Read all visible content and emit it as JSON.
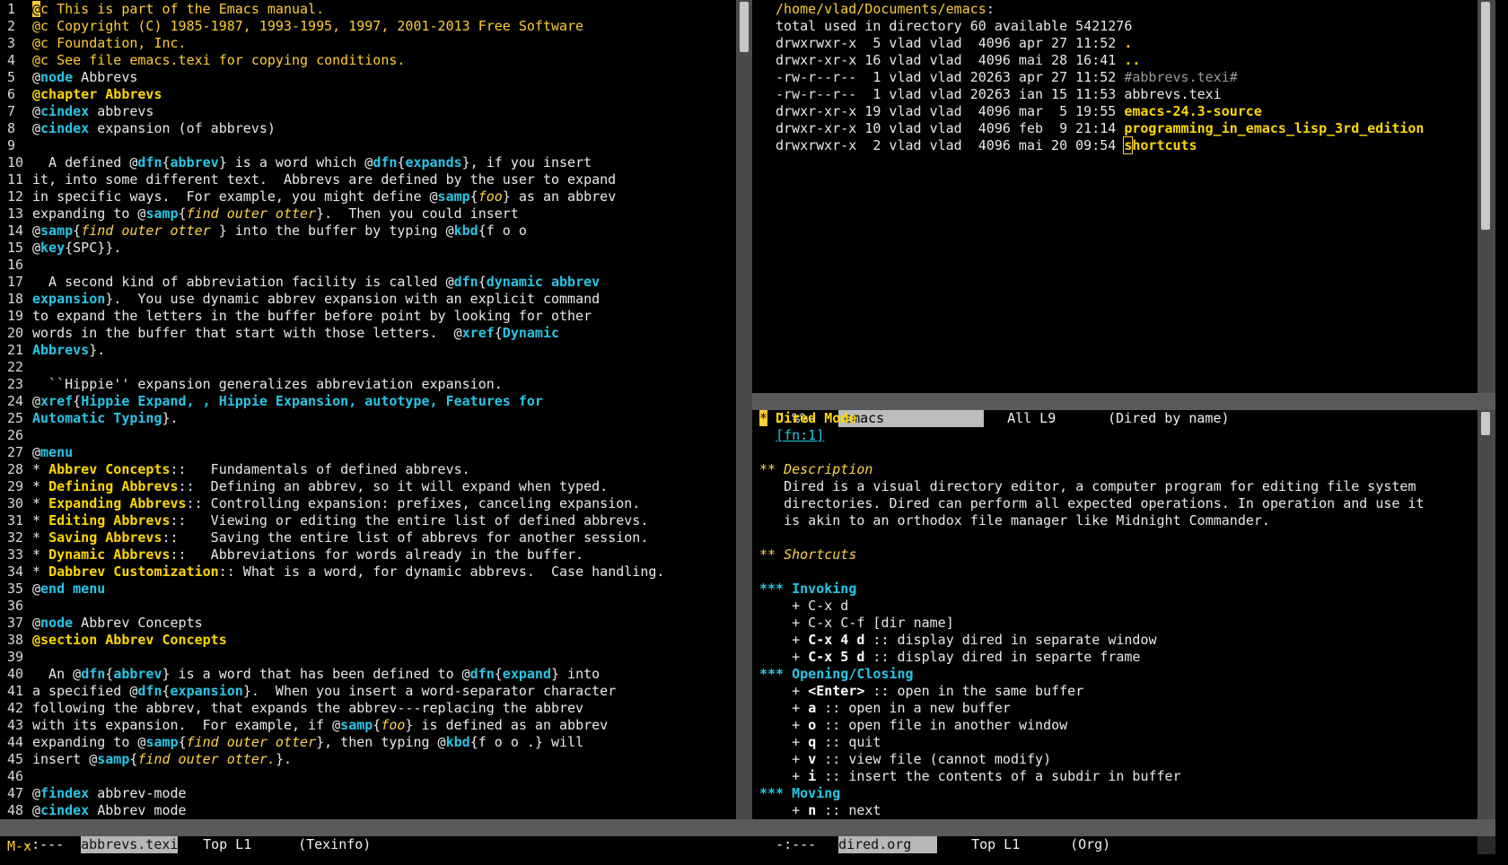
{
  "left": {
    "lines": [
      {
        "n": "1",
        "segs": [
          [
            "cursor",
            "@"
          ],
          [
            "c-yel",
            "c This is part of the Emacs manual."
          ]
        ]
      },
      {
        "n": "2",
        "segs": [
          [
            "c-yel",
            "@c Copyright (C) 1985-1987, 1993-1995, 1997, 2001-2013 Free Software"
          ]
        ]
      },
      {
        "n": "3",
        "segs": [
          [
            "c-yel",
            "@c Foundation, Inc."
          ]
        ]
      },
      {
        "n": "4",
        "segs": [
          [
            "c-yel",
            "@c See file emacs.texi for copying conditions."
          ]
        ]
      },
      {
        "n": "5",
        "segs": [
          [
            "",
            "@"
          ],
          [
            "c-cyanb",
            "node"
          ],
          [
            "",
            " Abbrevs"
          ]
        ]
      },
      {
        "n": "6",
        "segs": [
          [
            "c-kw",
            "@chapter Abbrevs"
          ]
        ]
      },
      {
        "n": "7",
        "segs": [
          [
            "",
            "@"
          ],
          [
            "c-cyanb",
            "cindex"
          ],
          [
            "",
            " abbrevs"
          ]
        ]
      },
      {
        "n": "8",
        "segs": [
          [
            "",
            "@"
          ],
          [
            "c-cyanb",
            "cindex"
          ],
          [
            "",
            " expansion (of abbrevs)"
          ]
        ]
      },
      {
        "n": "9",
        "segs": []
      },
      {
        "n": "10",
        "segs": [
          [
            "",
            "  A defined @"
          ],
          [
            "c-cyanb",
            "dfn"
          ],
          [
            "",
            "{"
          ],
          [
            "c-cyanb",
            "abbrev"
          ],
          [
            "",
            "} is a word which @"
          ],
          [
            "c-cyanb",
            "dfn"
          ],
          [
            "",
            "{"
          ],
          [
            "c-cyanb",
            "expands"
          ],
          [
            "",
            "}, if you insert"
          ]
        ]
      },
      {
        "n": "11",
        "segs": [
          [
            "",
            "it, into some different text.  Abbrevs are defined by the user to expand"
          ]
        ]
      },
      {
        "n": "12",
        "segs": [
          [
            "",
            "in specific ways.  For example, you might define @"
          ],
          [
            "c-cyanb",
            "samp"
          ],
          [
            "",
            "{"
          ],
          [
            "c-ital",
            "foo"
          ],
          [
            "",
            "} as an abbrev"
          ]
        ]
      },
      {
        "n": "13",
        "segs": [
          [
            "",
            "expanding to @"
          ],
          [
            "c-cyanb",
            "samp"
          ],
          [
            "",
            "{"
          ],
          [
            "c-ital",
            "find outer otter"
          ],
          [
            "",
            "}.  Then you could insert"
          ]
        ]
      },
      {
        "n": "14",
        "segs": [
          [
            "",
            "@"
          ],
          [
            "c-cyanb",
            "samp"
          ],
          [
            "",
            "{"
          ],
          [
            "c-ital",
            "find outer otter "
          ],
          [
            "",
            "} into the buffer by typing @"
          ],
          [
            "c-cyanb",
            "kbd"
          ],
          [
            "",
            "{f o o"
          ]
        ]
      },
      {
        "n": "15",
        "segs": [
          [
            "",
            "@"
          ],
          [
            "c-cyanb",
            "key"
          ],
          [
            "",
            "{SPC}}."
          ]
        ]
      },
      {
        "n": "16",
        "segs": []
      },
      {
        "n": "17",
        "segs": [
          [
            "",
            "  A second kind of abbreviation facility is called @"
          ],
          [
            "c-cyanb",
            "dfn"
          ],
          [
            "",
            "{"
          ],
          [
            "c-cyanb",
            "dynamic abbrev"
          ]
        ]
      },
      {
        "n": "18",
        "segs": [
          [
            "c-cyanb",
            "expansion"
          ],
          [
            "",
            "}.  You use dynamic abbrev expansion with an explicit command"
          ]
        ]
      },
      {
        "n": "19",
        "segs": [
          [
            "",
            "to expand the letters in the buffer before point by looking for other"
          ]
        ]
      },
      {
        "n": "20",
        "segs": [
          [
            "",
            "words in the buffer that start with those letters.  @"
          ],
          [
            "c-cyanb",
            "xref"
          ],
          [
            "",
            "{"
          ],
          [
            "c-cyanb",
            "Dynamic"
          ]
        ]
      },
      {
        "n": "21",
        "segs": [
          [
            "c-cyanb",
            "Abbrevs"
          ],
          [
            "",
            "}."
          ]
        ]
      },
      {
        "n": "22",
        "segs": []
      },
      {
        "n": "23",
        "segs": [
          [
            "",
            "  ``Hippie'' expansion generalizes abbreviation expansion."
          ]
        ]
      },
      {
        "n": "24",
        "segs": [
          [
            "",
            "@"
          ],
          [
            "c-cyanb",
            "xref"
          ],
          [
            "",
            "{"
          ],
          [
            "c-cyanb",
            "Hippie Expand, , Hippie Expansion, autotype, Features for"
          ]
        ]
      },
      {
        "n": "25",
        "segs": [
          [
            "c-cyanb",
            "Automatic Typing"
          ],
          [
            "",
            "}."
          ]
        ]
      },
      {
        "n": "26",
        "segs": []
      },
      {
        "n": "27",
        "segs": [
          [
            "",
            "@"
          ],
          [
            "c-cyanb",
            "menu"
          ]
        ]
      },
      {
        "n": "28",
        "segs": [
          [
            "",
            "* "
          ],
          [
            "c-kw",
            "Abbrev Concepts"
          ],
          [
            "",
            "::   Fundamentals of defined abbrevs."
          ]
        ]
      },
      {
        "n": "29",
        "segs": [
          [
            "",
            "* "
          ],
          [
            "c-kw",
            "Defining Abbrevs"
          ],
          [
            "",
            "::  Defining an abbrev, so it will expand when typed."
          ]
        ]
      },
      {
        "n": "30",
        "segs": [
          [
            "",
            "* "
          ],
          [
            "c-kw",
            "Expanding Abbrevs"
          ],
          [
            "",
            ":: Controlling expansion: prefixes, canceling expansion."
          ]
        ]
      },
      {
        "n": "31",
        "segs": [
          [
            "",
            "* "
          ],
          [
            "c-kw",
            "Editing Abbrevs"
          ],
          [
            "",
            "::   Viewing or editing the entire list of defined abbrevs."
          ]
        ]
      },
      {
        "n": "32",
        "segs": [
          [
            "",
            "* "
          ],
          [
            "c-kw",
            "Saving Abbrevs"
          ],
          [
            "",
            "::    Saving the entire list of abbrevs for another session."
          ]
        ]
      },
      {
        "n": "33",
        "segs": [
          [
            "",
            "* "
          ],
          [
            "c-kw",
            "Dynamic Abbrevs"
          ],
          [
            "",
            "::   Abbreviations for words already in the buffer."
          ]
        ]
      },
      {
        "n": "34",
        "segs": [
          [
            "",
            "* "
          ],
          [
            "c-kw",
            "Dabbrev Customization"
          ],
          [
            "",
            ":: What is a word, for dynamic abbrevs.  Case handling."
          ]
        ]
      },
      {
        "n": "35",
        "segs": [
          [
            "",
            "@"
          ],
          [
            "c-cyanb",
            "end menu"
          ]
        ]
      },
      {
        "n": "36",
        "segs": []
      },
      {
        "n": "37",
        "segs": [
          [
            "",
            "@"
          ],
          [
            "c-cyanb",
            "node"
          ],
          [
            "",
            " Abbrev Concepts"
          ]
        ]
      },
      {
        "n": "38",
        "segs": [
          [
            "c-kw",
            "@section Abbrev Concepts"
          ]
        ]
      },
      {
        "n": "39",
        "segs": []
      },
      {
        "n": "40",
        "segs": [
          [
            "",
            "  An @"
          ],
          [
            "c-cyanb",
            "dfn"
          ],
          [
            "",
            "{"
          ],
          [
            "c-cyanb",
            "abbrev"
          ],
          [
            "",
            "} is a word that has been defined to @"
          ],
          [
            "c-cyanb",
            "dfn"
          ],
          [
            "",
            "{"
          ],
          [
            "c-cyanb",
            "expand"
          ],
          [
            "",
            "} into"
          ]
        ]
      },
      {
        "n": "41",
        "segs": [
          [
            "",
            "a specified @"
          ],
          [
            "c-cyanb",
            "dfn"
          ],
          [
            "",
            "{"
          ],
          [
            "c-cyanb",
            "expansion"
          ],
          [
            "",
            "}.  When you insert a word-separator character"
          ]
        ]
      },
      {
        "n": "42",
        "segs": [
          [
            "",
            "following the abbrev, that expands the abbrev---replacing the abbrev"
          ]
        ]
      },
      {
        "n": "43",
        "segs": [
          [
            "",
            "with its expansion.  For example, if @"
          ],
          [
            "c-cyanb",
            "samp"
          ],
          [
            "",
            "{"
          ],
          [
            "c-ital",
            "foo"
          ],
          [
            "",
            "} is defined as an abbrev"
          ]
        ]
      },
      {
        "n": "44",
        "segs": [
          [
            "",
            "expanding to @"
          ],
          [
            "c-cyanb",
            "samp"
          ],
          [
            "",
            "{"
          ],
          [
            "c-ital",
            "find outer otter"
          ],
          [
            "",
            "}, then typing @"
          ],
          [
            "c-cyanb",
            "kbd"
          ],
          [
            "",
            "{f o o .} will"
          ]
        ]
      },
      {
        "n": "45",
        "segs": [
          [
            "",
            "insert @"
          ],
          [
            "c-cyanb",
            "samp"
          ],
          [
            "",
            "{"
          ],
          [
            "c-ital",
            "find outer otter."
          ],
          [
            "",
            "}."
          ]
        ]
      },
      {
        "n": "46",
        "segs": []
      },
      {
        "n": "47",
        "segs": [
          [
            "",
            "@"
          ],
          [
            "c-cyanb",
            "findex"
          ],
          [
            "",
            " abbrev-mode"
          ]
        ]
      },
      {
        "n": "48",
        "segs": [
          [
            "",
            "@"
          ],
          [
            "c-cyanb",
            "cindex"
          ],
          [
            "",
            " Abbrev mode"
          ]
        ]
      }
    ],
    "modeline": {
      "state": "-:---",
      "buffer": "abbrevs.texi",
      "pos": "Top L1",
      "mode": "(Texinfo)"
    }
  },
  "dired": {
    "lines": [
      [
        [
          "c-yel",
          "/home/vlad/Documents/emacs"
        ],
        [
          "",
          ":"
        ]
      ],
      [
        [
          "",
          "total used in directory 60 available 5421276"
        ]
      ],
      [
        [
          "",
          "drwxr"
        ],
        [
          "c-wrx",
          "wx"
        ],
        [
          "",
          "r-x  5 vlad vlad  4096 apr 27 11:52 "
        ],
        [
          "c-kw",
          "."
        ]
      ],
      [
        [
          "",
          "drwxr-xr-x 16 vlad vlad  4096 mai 28 16:41 "
        ],
        [
          "c-kw",
          ".."
        ]
      ],
      [
        [
          "",
          "-rw-r--r--  1 vlad vlad 20263 apr 27 11:52 "
        ],
        [
          "c-dim",
          "#abbrevs.texi#"
        ]
      ],
      [
        [
          "",
          "-rw-r--r--  1 vlad vlad 20263 ian 15 11:53 abbrevs.texi"
        ]
      ],
      [
        [
          "",
          "drwxr-xr-x 19 vlad vlad  4096 mar  5 19:55 "
        ],
        [
          "c-kw",
          "emacs-24.3-source"
        ]
      ],
      [
        [
          "",
          "drwxr-xr-x 10 vlad vlad  4096 feb  9 21:14 "
        ],
        [
          "c-kw",
          "programming_in_emacs_lisp_3rd_edition"
        ]
      ],
      [
        [
          "",
          "drwxr"
        ],
        [
          "c-wrx",
          "wx"
        ],
        [
          "",
          "r-x  2 vlad vlad  4096 mai 20 09:54 "
        ],
        [
          "cursor-box c-kw",
          "s"
        ],
        [
          "c-kw",
          "hortcuts"
        ]
      ]
    ],
    "modeline": {
      "state": "U:%%-",
      "buffer": "emacs",
      "pos": "All L9",
      "mode": "(Dired by name)"
    }
  },
  "org": {
    "lines": [
      [
        [
          "cursor",
          "*"
        ],
        [
          "c-kw",
          " Dired Mode"
        ]
      ],
      [
        [
          "",
          "  "
        ],
        [
          "c-lnk",
          "[fn:1]"
        ]
      ],
      [],
      [
        [
          "c-ital",
          "** Description"
        ]
      ],
      [
        [
          "",
          "   Dired is a visual directory editor, a computer program for editing file system"
        ]
      ],
      [
        [
          "",
          "   directories. Dired can perform all expected operations. In operation and use it"
        ]
      ],
      [
        [
          "",
          "   is akin to an orthodox file manager like Midnight Commander."
        ]
      ],
      [],
      [
        [
          "c-ital",
          "** Shortcuts"
        ]
      ],
      [],
      [
        [
          "c-cyanb",
          "*** Invoking"
        ]
      ],
      [
        [
          "",
          "    + C-x d"
        ]
      ],
      [
        [
          "",
          "    + C-x C-f [dir name]"
        ]
      ],
      [
        [
          "",
          "    + "
        ],
        [
          "c-bold",
          "C-x 4 d"
        ],
        [
          "",
          " :: display dired in separate window"
        ]
      ],
      [
        [
          "",
          "    + "
        ],
        [
          "c-bold",
          "C-x 5 d"
        ],
        [
          "",
          " :: display dired in separte frame"
        ]
      ],
      [
        [
          "c-cyanb",
          "*** Opening/Closing"
        ]
      ],
      [
        [
          "",
          "    + "
        ],
        [
          "c-bold",
          "<Enter>"
        ],
        [
          "",
          " :: open in the same buffer"
        ]
      ],
      [
        [
          "",
          "    + "
        ],
        [
          "c-bold",
          "a"
        ],
        [
          "",
          " :: open in a new buffer"
        ]
      ],
      [
        [
          "",
          "    + "
        ],
        [
          "c-bold",
          "o"
        ],
        [
          "",
          " :: open file in another window"
        ]
      ],
      [
        [
          "",
          "    + "
        ],
        [
          "c-bold",
          "q"
        ],
        [
          "",
          " :: quit"
        ]
      ],
      [
        [
          "",
          "    + "
        ],
        [
          "c-bold",
          "v"
        ],
        [
          "",
          " :: view file (cannot modify)"
        ]
      ],
      [
        [
          "",
          "    + "
        ],
        [
          "c-bold",
          "i"
        ],
        [
          "",
          " :: insert the contents of a subdir in buffer"
        ]
      ],
      [
        [
          "c-cyanb",
          "*** Moving"
        ]
      ],
      [
        [
          "",
          "    + "
        ],
        [
          "c-bold",
          "n"
        ],
        [
          "",
          " :: next"
        ]
      ]
    ],
    "modeline": {
      "state": "-:---",
      "buffer": "dired.org",
      "pos": "Top L1",
      "mode": "(Org)"
    }
  },
  "minibuffer": {
    "text": "M-x"
  }
}
